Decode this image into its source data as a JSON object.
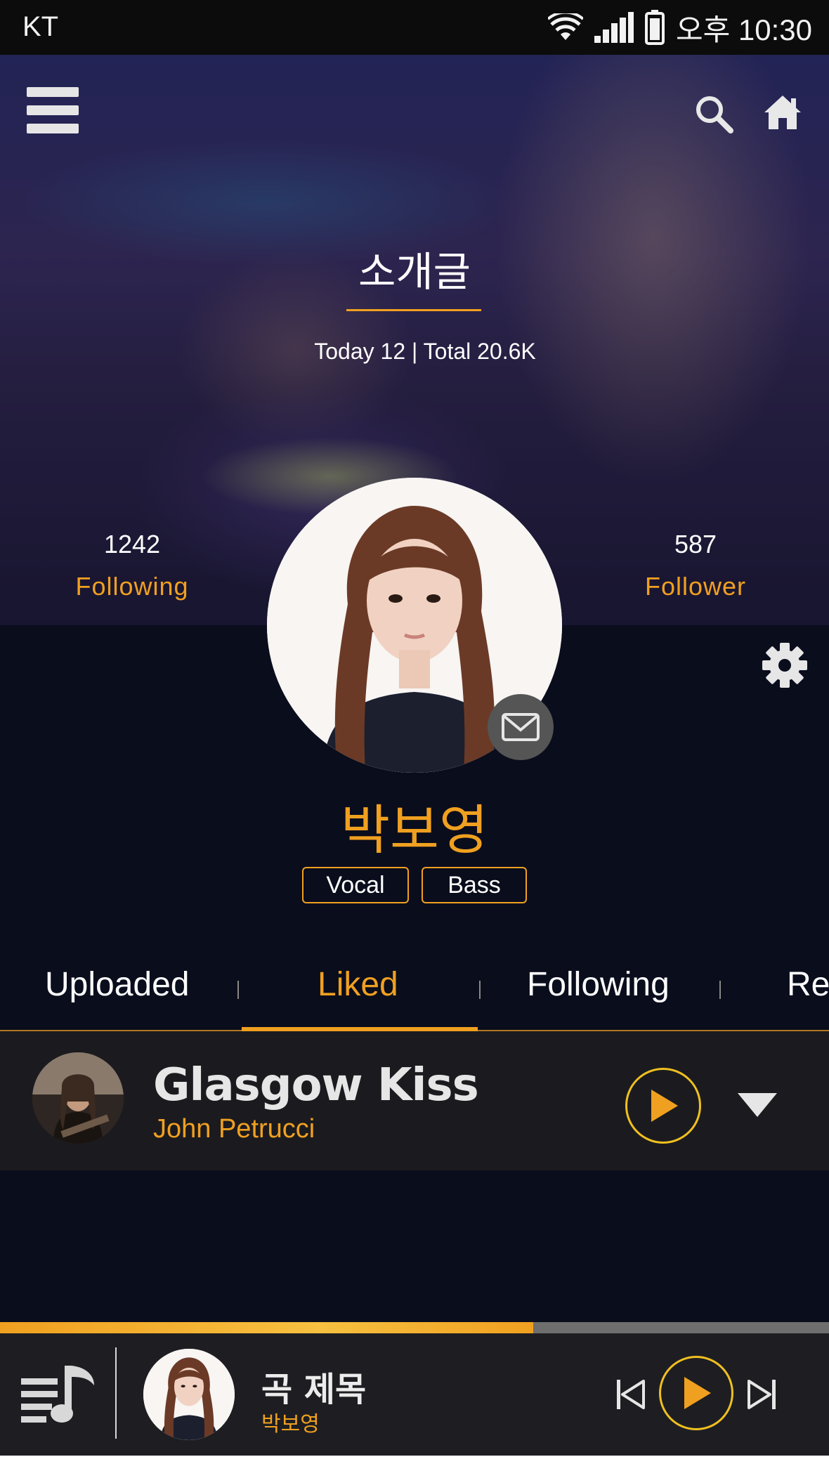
{
  "status_bar": {
    "carrier": "KT",
    "time": "오후 10:30",
    "icons": [
      "wifi-icon",
      "signal-icon",
      "battery-icon"
    ]
  },
  "header": {
    "menu_icon": "hamburger-menu-icon",
    "search_icon": "search-icon",
    "home_icon": "home-icon"
  },
  "intro": {
    "title": "소개글",
    "visits": "Today 12 | Total 20.6K"
  },
  "stats": {
    "following_count": "1242",
    "following_label": "Following",
    "follower_count": "587",
    "follower_label": "Follower"
  },
  "profile": {
    "name": "박보영",
    "tags": [
      "Vocal",
      "Bass"
    ],
    "message_icon": "envelope-icon",
    "settings_icon": "gear-icon"
  },
  "tabs": [
    {
      "label": "Uploaded",
      "active": false
    },
    {
      "label": "Liked",
      "active": true
    },
    {
      "label": "Following",
      "active": false
    },
    {
      "label": "Re",
      "active": false
    }
  ],
  "songs": [
    {
      "title": "Glasgow Kiss",
      "artist": "John Petrucci"
    }
  ],
  "player": {
    "title": "곡 제목",
    "artist": "박보영",
    "progress": 0.643
  },
  "colors": {
    "accent": "#f0a020",
    "background": "#0a0d1c",
    "panel": "#1b1b1f"
  }
}
